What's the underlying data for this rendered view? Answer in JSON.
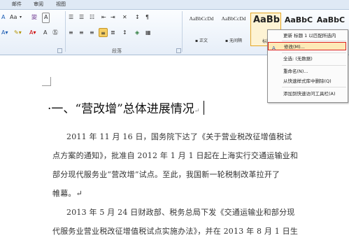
{
  "tabs": [
    "邮件",
    "审阅",
    "视图"
  ],
  "font_row": [
    "A",
    "Aa",
    "▾",
    "變",
    "A"
  ],
  "para_row1": [
    "☰",
    "☰",
    "☷",
    "⇤",
    "⇥",
    "✕",
    "↕",
    "¶"
  ],
  "para_row2": [
    "≡",
    "≡",
    "≡",
    "≡",
    "≣",
    "↕",
    "◈",
    "▦"
  ],
  "group_label": "段落",
  "styles": [
    {
      "sample": "AaBbCcDd",
      "name": "▪ 正文"
    },
    {
      "sample": "AaBbCcDd",
      "name": "▪ 无间隔"
    },
    {
      "sample": "AaBb",
      "name": "标题"
    },
    {
      "sample": "AaBbC",
      "name": ""
    },
    {
      "sample": "AaBbC",
      "name": ""
    }
  ],
  "menu": {
    "items": [
      {
        "label": "更新 标题 1 以匹配所选内",
        "icon": ""
      },
      {
        "label": "修改(M)...",
        "icon": "A"
      },
      {
        "label": "全选: (无数据)",
        "icon": ""
      },
      {
        "label": "重命名(N)...",
        "icon": ""
      },
      {
        "label": "从快速样式库中删除(Q)",
        "icon": ""
      },
      {
        "label": "添加到快速访问工具栏(A)",
        "icon": ""
      }
    ]
  },
  "document": {
    "heading": "·一、“营改增”总体进展情况",
    "heading_mark": "↵",
    "lines": [
      "2011 年 11 月 16 日，国务院下达了《关于营业税改征增值税试",
      "点方案的通知》，批准自 2012 年 1 月 1 日起在上海实行交通运输业和",
      "部分现代服务业“营改增”试点。至此，我国新一轮税制改革拉开了",
      "帷幕。↵",
      "2013 年 5 月 24 日财政部、税务总局下发《交通运输业和部分现",
      "代服务业营业税改征增值税试点实施办法》，并在 2013 年 8 月 1 日生"
    ]
  },
  "colors": {
    "accent_highlight": "#f6cf63",
    "menu_outline": "#dd2222"
  }
}
